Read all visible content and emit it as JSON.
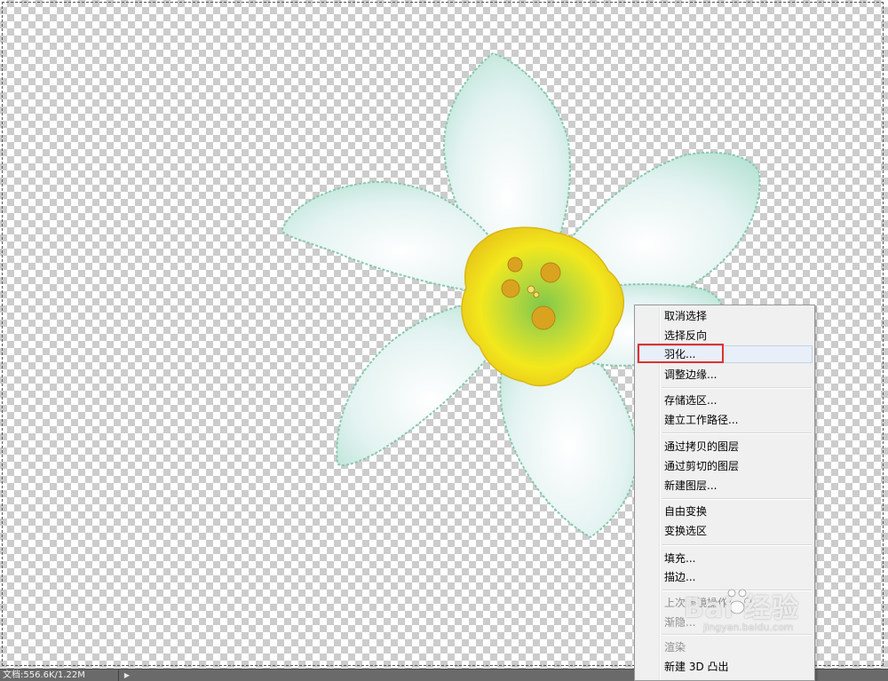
{
  "status_bar": {
    "doc_info": "文档:556.6K/1.22M",
    "arrow_icon": "triangle-right-icon"
  },
  "context_menu": {
    "items": [
      {
        "label": "取消选择",
        "enabled": true
      },
      {
        "label": "选择反向",
        "enabled": true
      },
      {
        "label": "羽化...",
        "enabled": true,
        "highlighted": true
      },
      {
        "label": "调整边缘...",
        "enabled": true
      },
      {
        "label": "存储选区...",
        "enabled": true
      },
      {
        "label": "建立工作路径...",
        "enabled": true
      },
      {
        "label": "通过拷贝的图层",
        "enabled": true
      },
      {
        "label": "通过剪切的图层",
        "enabled": true
      },
      {
        "label": "新建图层...",
        "enabled": true
      },
      {
        "label": "自由变换",
        "enabled": true
      },
      {
        "label": "变换选区",
        "enabled": true
      },
      {
        "label": "填充...",
        "enabled": true
      },
      {
        "label": "描边...",
        "enabled": true
      },
      {
        "label": "上次滤镜操作",
        "enabled": false
      },
      {
        "label": "渐隐...",
        "enabled": false
      },
      {
        "label": "渲染",
        "enabled": false
      },
      {
        "label": "新建 3D 凸出",
        "enabled": true
      }
    ]
  },
  "annotation": {
    "highlight_color": "#e03131"
  },
  "watermark": {
    "brand": "Bai 经验",
    "url": "jingyan.baidu.com",
    "icon": "baidu-paw-icon"
  },
  "colors": {
    "petal": "#e6f4f2",
    "petal_edge": "#8fcfb8",
    "trumpet": "#f2e21a",
    "stamen": "#d9a320",
    "menu_bg": "#f0f0f0",
    "status_bg": "#6a6a6a"
  }
}
